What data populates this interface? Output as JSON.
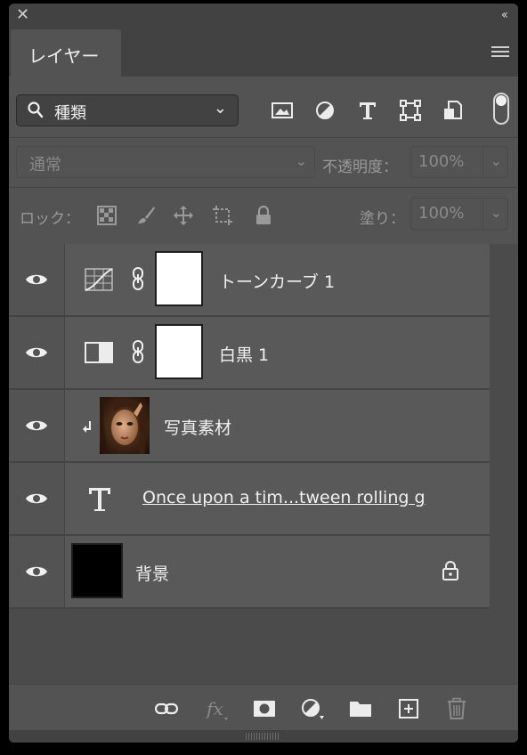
{
  "panel": {
    "tab_label": "レイヤー",
    "close_glyph": "✕",
    "collapse_glyph": "‹‹"
  },
  "filter": {
    "kind_label": "種類",
    "icons": [
      "image-filter-icon",
      "adjustment-filter-icon",
      "type-filter-icon",
      "shape-filter-icon",
      "smart-object-filter-icon"
    ]
  },
  "blend": {
    "mode": "通常",
    "opacity_label": "不透明度：",
    "opacity_value": "100%"
  },
  "lock": {
    "label": "ロック：",
    "fill_label": "塗り：",
    "fill_value": "100%"
  },
  "layers": [
    {
      "name": "トーンカーブ 1",
      "type": "curves-adjustment"
    },
    {
      "name": "白黒 1",
      "type": "black-white-adjustment"
    },
    {
      "name": "写真素材",
      "type": "clipped-image"
    },
    {
      "name": "Once upon a tim...tween rolling g",
      "type": "text"
    },
    {
      "name": "背景",
      "type": "background"
    }
  ],
  "colors": {
    "panel_bg": "#535353",
    "layer_bg": "#595959",
    "titlebar_bg": "#424242",
    "text": "#f0f0f0"
  }
}
